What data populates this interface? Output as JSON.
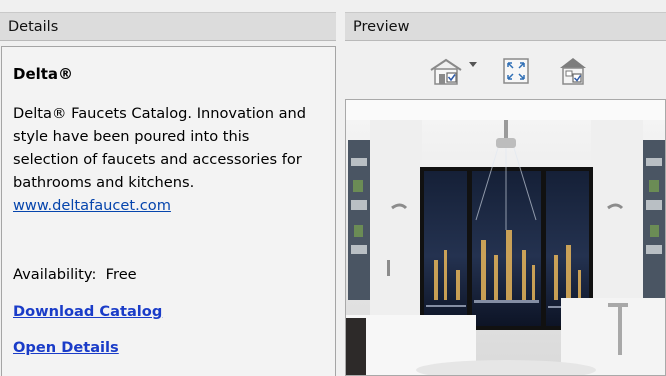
{
  "details_header": {
    "title": "Details"
  },
  "preview_header": {
    "title": "Preview"
  },
  "details": {
    "name": "Delta®",
    "description": "Delta® Faucets Catalog. Innovation and style have been poured into this selection of faucets and accessories for bathrooms and kitchens.",
    "website": "www.deltafaucet.com",
    "availability": "Availability:  Free",
    "download_label": "Download Catalog",
    "open_details_label": "Open Details"
  },
  "toolbar": {
    "icons": [
      "house-view-icon",
      "dropdown-arrow-icon",
      "fit-view-icon",
      "3d-house-icon"
    ]
  },
  "preview": {
    "image": "bathroom-with-city-view-windows"
  },
  "colors": {
    "header_bg": "#dcdcdc",
    "panel_bg": "#f3f3f3",
    "link": "#0645ad",
    "action_link": "#1a3cc8"
  }
}
